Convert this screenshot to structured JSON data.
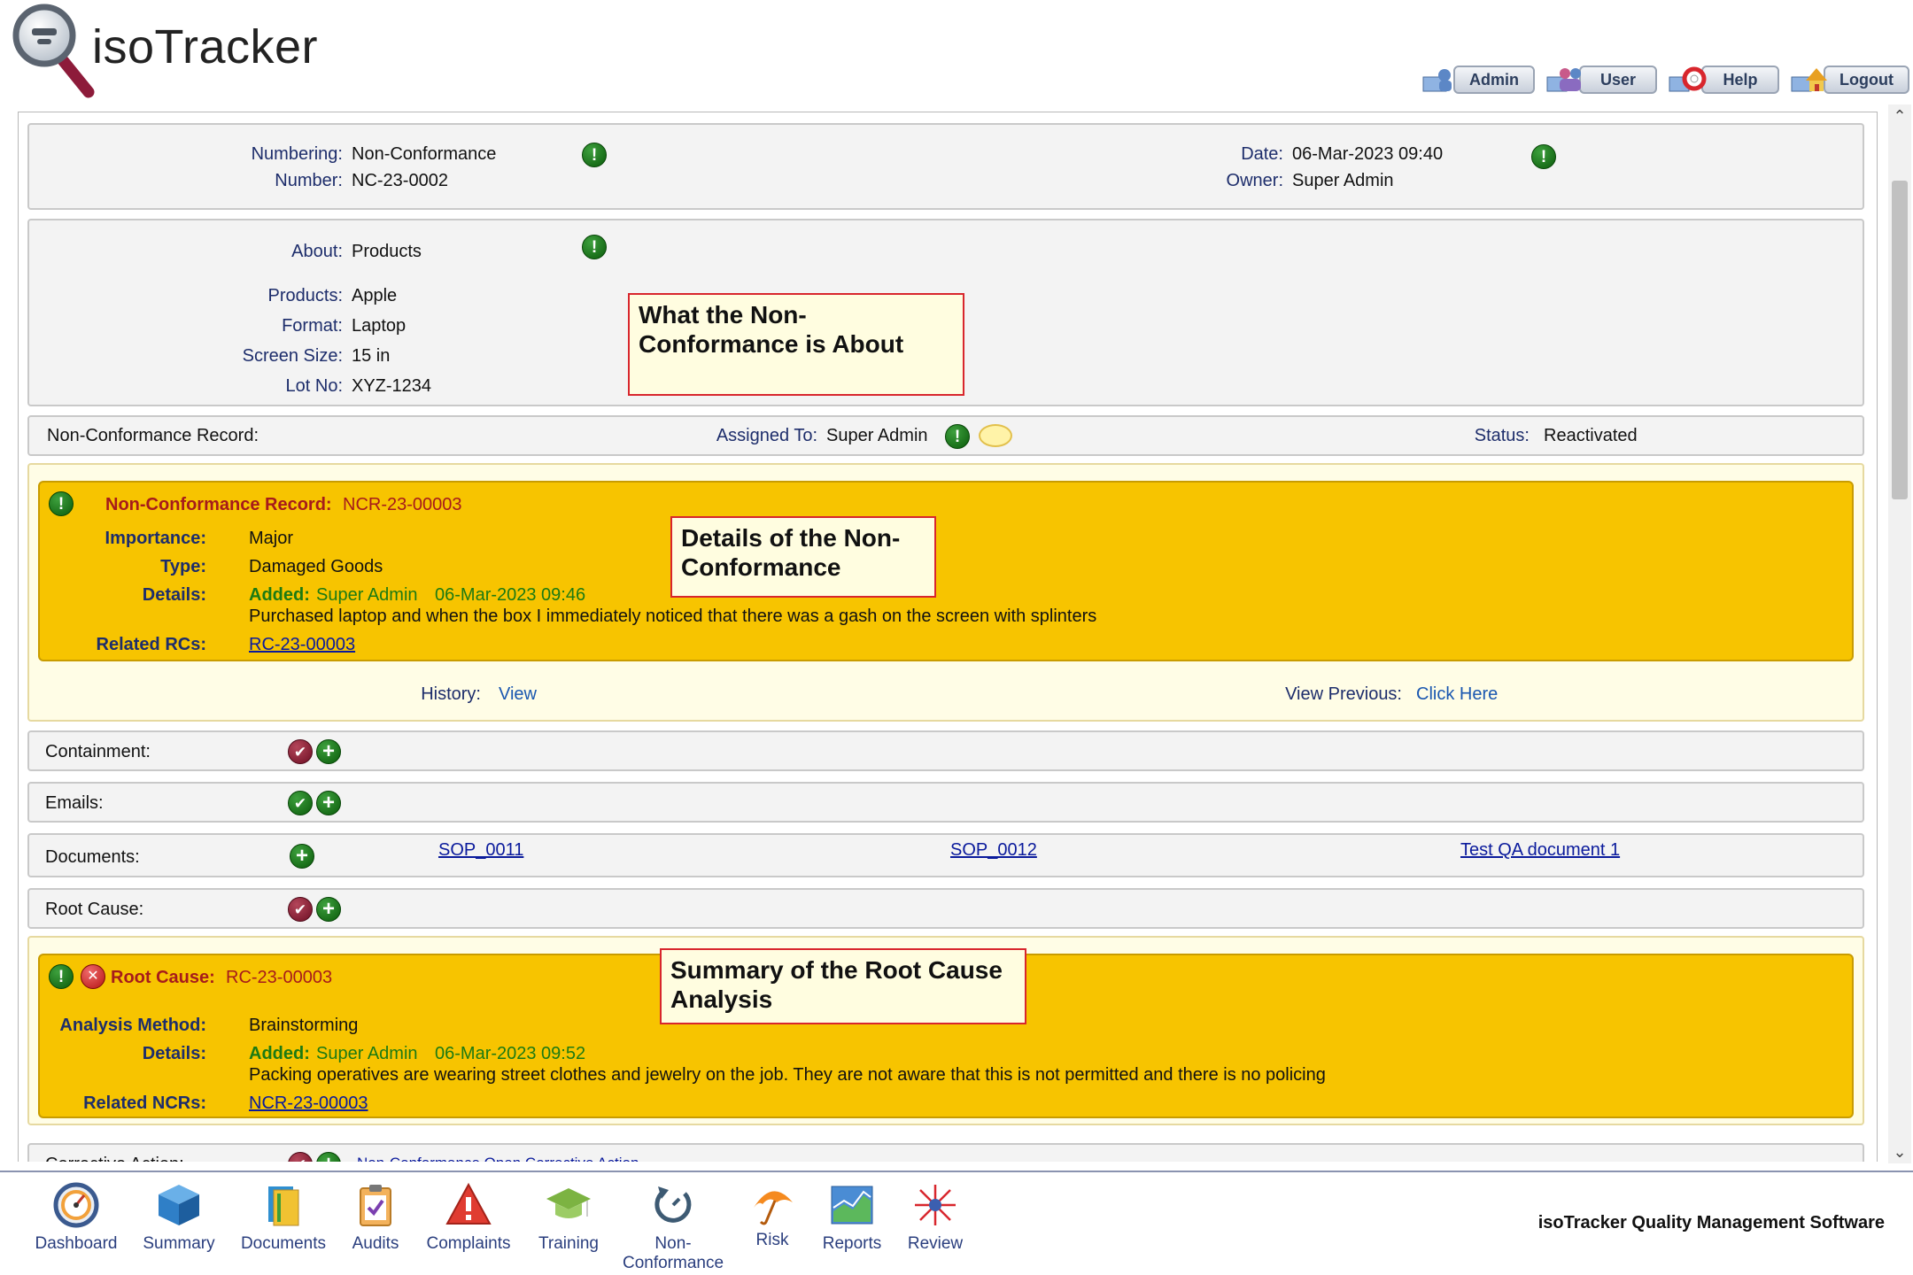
{
  "app": {
    "logo_text": "isoTracker"
  },
  "top_nav": [
    {
      "label": "Admin",
      "icon": "admin-icon"
    },
    {
      "label": "User",
      "icon": "users-icon"
    },
    {
      "label": "Help",
      "icon": "help-icon"
    },
    {
      "label": "Logout",
      "icon": "logout-icon"
    }
  ],
  "header_panel": {
    "numbering_label": "Numbering:",
    "numbering_value": "Non-Conformance",
    "number_label": "Number:",
    "number_value": "NC-23-0002",
    "date_label": "Date:",
    "date_value": "06-Mar-2023 09:40",
    "owner_label": "Owner:",
    "owner_value": "Super Admin"
  },
  "about_panel": {
    "about_label": "About:",
    "about_value": "Products",
    "products_label": "Products:",
    "products_value": "Apple",
    "format_label": "Format:",
    "format_value": "Laptop",
    "screen_label": "Screen Size:",
    "screen_value": "15 in",
    "lot_label": "Lot No:",
    "lot_value": "XYZ-1234",
    "callout": "What the Non-Conformance is About"
  },
  "ncr_bar": {
    "title": "Non-Conformance Record:",
    "assigned_label": "Assigned To:",
    "assigned_value": "Super Admin",
    "status_label": "Status:",
    "status_value": "Reactivated"
  },
  "ncr_card": {
    "title": "Non-Conformance Record:",
    "id": "NCR-23-00003",
    "importance_label": "Importance:",
    "importance_value": "Major",
    "type_label": "Type:",
    "type_value": "Damaged Goods",
    "details_label": "Details:",
    "added_label": "Added:",
    "added_by": "Super Admin",
    "added_date": "06-Mar-2023 09:46",
    "details_text": "Purchased laptop and when the box I immediately noticed that there was a gash on the screen with splinters",
    "related_label": "Related RCs:",
    "related_value": "RC-23-00003",
    "callout": "Details of the Non-Conformance",
    "history_label": "History:",
    "history_link": "View",
    "previous_label": "View Previous:",
    "previous_link": "Click Here"
  },
  "sections": {
    "containment": "Containment:",
    "emails": "Emails:",
    "documents": "Documents:",
    "root_cause": "Root Cause:",
    "corrective_action": "Corrective Action:",
    "corrective_link": "Non-Conformance Open Corrective Action"
  },
  "documents": [
    "SOP_0011",
    "SOP_0012",
    "Test QA document 1"
  ],
  "rc_card": {
    "title": "Root Cause:",
    "id": "RC-23-00003",
    "method_label": "Analysis Method:",
    "method_value": "Brainstorming",
    "details_label": "Details:",
    "added_label": "Added:",
    "added_by": "Super Admin",
    "added_date": "06-Mar-2023 09:52",
    "details_text": "Packing operatives are wearing street clothes and jewelry on the job. They are not aware that this is not permitted and there is no policing",
    "related_label": "Related NCRs:",
    "related_value": "NCR-23-00003",
    "callout": "Summary of the Root Cause Analysis"
  },
  "bottom_nav": [
    {
      "label": "Dashboard",
      "icon": "dashboard-gauge-icon"
    },
    {
      "label": "Summary",
      "icon": "summary-cube-icon"
    },
    {
      "label": "Documents",
      "icon": "documents-book-icon"
    },
    {
      "label": "Audits",
      "icon": "audits-clipboard-icon"
    },
    {
      "label": "Complaints",
      "icon": "complaints-warning-icon"
    },
    {
      "label": "Training",
      "icon": "training-cap-icon"
    },
    {
      "label": "Non-Conformance",
      "label_line1": "Non-",
      "label_line2": "Conformance",
      "icon": "nonconformance-cycle-icon"
    },
    {
      "label": "Risk",
      "icon": "risk-umbrella-icon"
    },
    {
      "label": "Reports",
      "icon": "reports-chart-icon"
    },
    {
      "label": "Review",
      "icon": "review-star-icon"
    }
  ],
  "footer": {
    "brand": "isoTracker Quality Management Software"
  }
}
